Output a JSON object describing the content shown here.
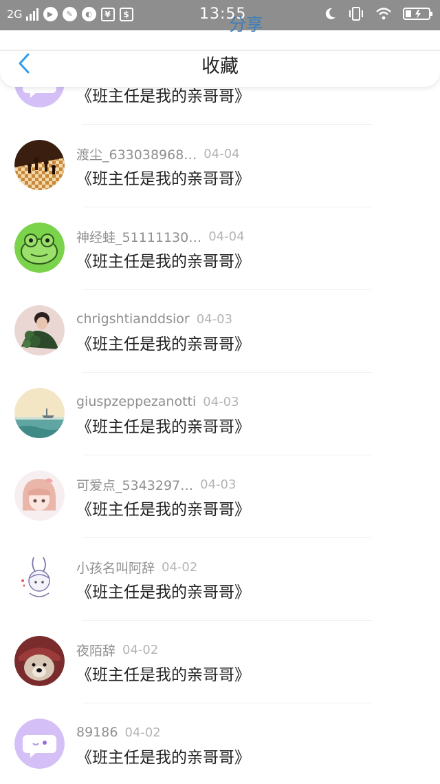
{
  "status_bar": {
    "network": "2G",
    "time": "13:55",
    "app_icons": [
      "play-icon",
      "palette-icon",
      "browser-icon",
      "cash-icon",
      "wallet-icon"
    ],
    "right_icons": [
      "moon-icon",
      "vibrate-icon",
      "wifi-icon",
      "battery-icon"
    ]
  },
  "share_overlay": "分享",
  "header": {
    "title": "收藏",
    "back_icon": "chevron-left-icon"
  },
  "colors": {
    "accent": "#2f9cf0",
    "status_bar": "#8e8e8e",
    "username": "#8f8f8f",
    "date": "#b4b4b4",
    "content_text": "#222222"
  },
  "favorites": [
    {
      "username": "",
      "date": "",
      "content": "《班主任是我的亲哥哥》",
      "avatar": "chat-bubble-avatar"
    },
    {
      "username": "渡尘_633038968…",
      "date": "04-04",
      "content": "《班主任是我的亲哥哥》",
      "avatar": "chess-avatar"
    },
    {
      "username": "神经蛙_51111130…",
      "date": "04-04",
      "content": "《班主任是我的亲哥哥》",
      "avatar": "frog-avatar"
    },
    {
      "username": "chrigshtianddsior",
      "date": "04-03",
      "content": "《班主任是我的亲哥哥》",
      "avatar": "girl-plant-avatar"
    },
    {
      "username": "giuspzeppezanotti",
      "date": "04-03",
      "content": "《班主任是我的亲哥哥》",
      "avatar": "sea-ship-avatar"
    },
    {
      "username": "可爱点_5343297…",
      "date": "04-03",
      "content": "《班主任是我的亲哥哥》",
      "avatar": "anime-girl-avatar"
    },
    {
      "username": "小孩名叫阿辞",
      "date": "04-02",
      "content": "《班主任是我的亲哥哥》",
      "avatar": "bunny-sketch-avatar"
    },
    {
      "username": "夜陌辞",
      "date": "04-02",
      "content": "《班主任是我的亲哥哥》",
      "avatar": "dog-avatar"
    },
    {
      "username": "89186",
      "date": "04-02",
      "content": "《班主任是我的亲哥哥》",
      "avatar": "chat-bubble-avatar"
    }
  ]
}
